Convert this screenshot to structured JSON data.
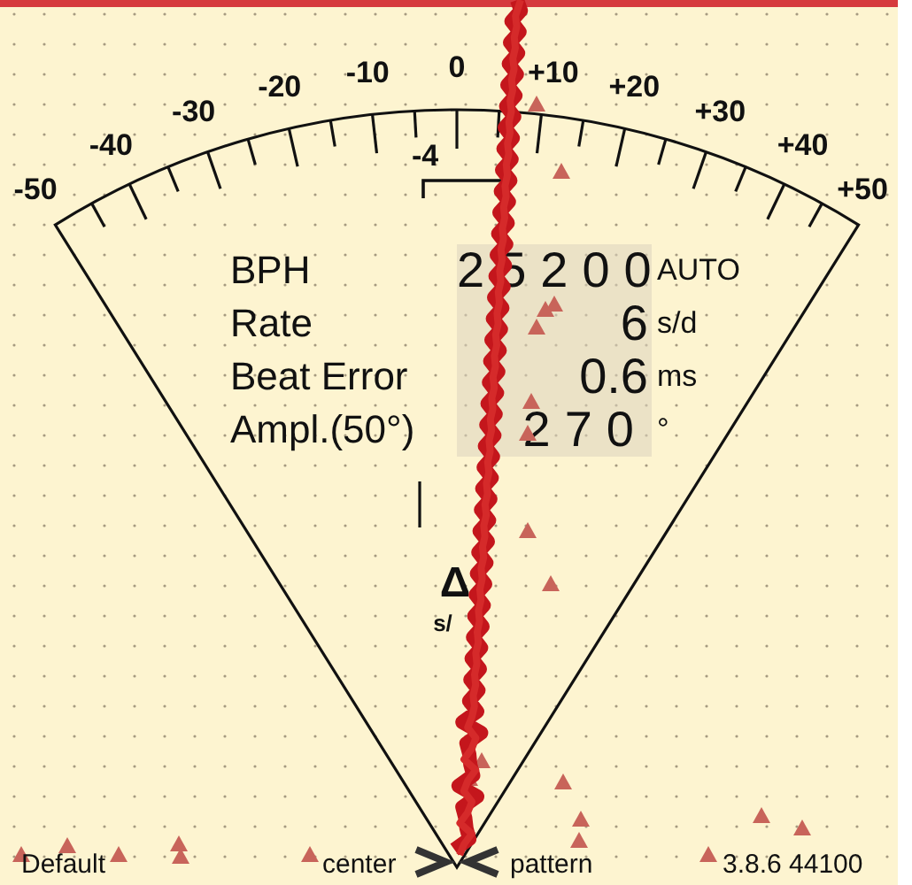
{
  "scale": {
    "labels": [
      "-50",
      "-40",
      "-30",
      "-20",
      "-10",
      "0",
      "+10",
      "+20",
      "+30",
      "+40",
      "+50"
    ],
    "beat_error_label": "-4"
  },
  "readings": [
    {
      "label": "BPH",
      "value": "25200",
      "unit": "AUTO",
      "spaced": true
    },
    {
      "label": "Rate",
      "value": "6",
      "unit": "s/d",
      "spaced": false
    },
    {
      "label": "Beat Error",
      "value": "0.6",
      "unit": "ms",
      "spaced": false
    },
    {
      "label": "Ampl.(50°)",
      "value": "270",
      "unit": "°",
      "spaced": true
    }
  ],
  "delta": {
    "symbol": "Δ",
    "unit": "s/"
  },
  "bottom_bar": {
    "profile": "Default",
    "center": "center",
    "pattern": "pattern",
    "version": "3.8.6 44100"
  }
}
